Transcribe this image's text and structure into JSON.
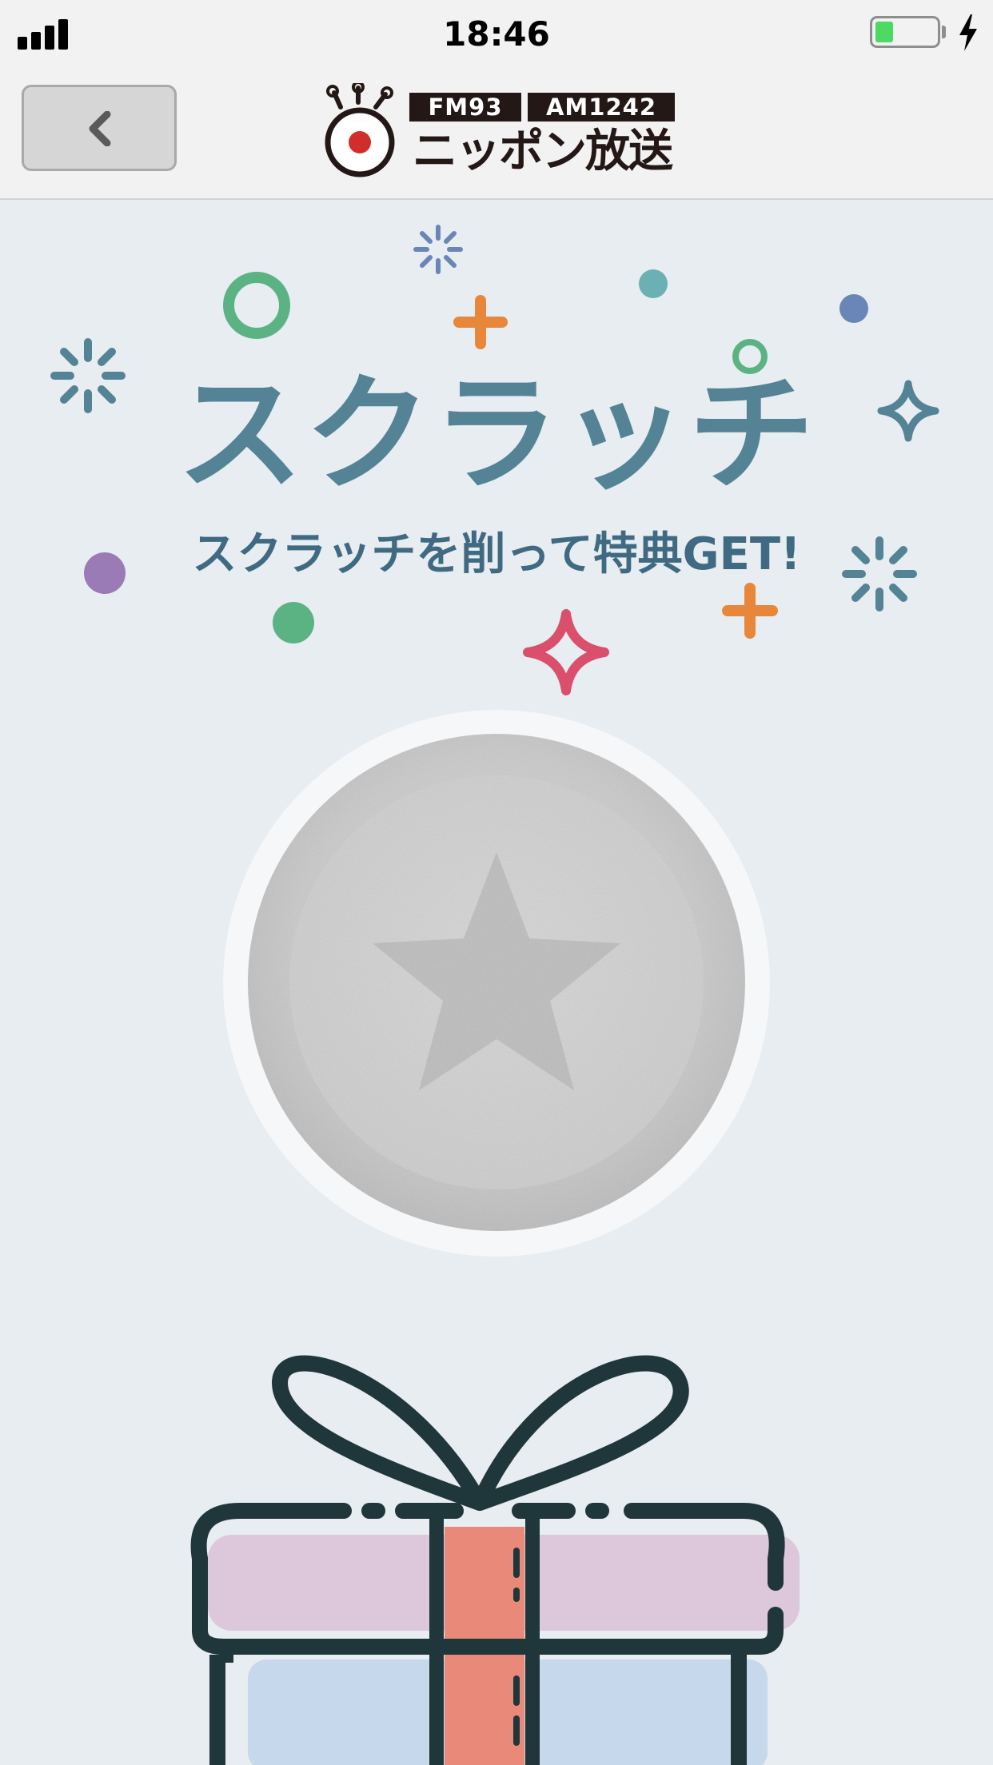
{
  "status_bar": {
    "time": "18:46",
    "battery_level": 0.3,
    "charging": true,
    "signal_bars": 4
  },
  "nav": {
    "back_icon": "chevron-left-icon",
    "logo": {
      "badge_fm": "FM93",
      "badge_am": "AM1242",
      "name": "ニッポン放送"
    }
  },
  "main": {
    "title": "スクラッチ",
    "subtitle": "スクラッチを削って特典GET!",
    "scratch_card": {
      "icon": "star-icon"
    },
    "illustration": {
      "icon": "gift-box-icon"
    }
  },
  "colors": {
    "background": "#e7edf0",
    "title": "#538395",
    "subtitle": "#3f6a82",
    "accent_orange": "#e8873a",
    "accent_green": "#5bb383",
    "accent_pink": "#d94f6c",
    "accent_purple": "#9b7bb6",
    "accent_teal": "#6bb0b2",
    "accent_blue": "#6a86b8"
  }
}
